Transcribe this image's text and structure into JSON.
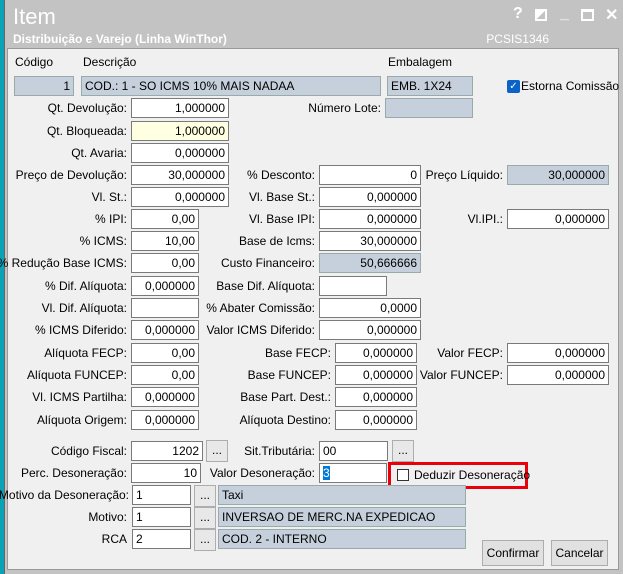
{
  "window": {
    "title": "Item",
    "subtitle": "Distribuição e Varejo (Linha WinThor)",
    "code": "PCSIS1346",
    "help": "?",
    "min": "_",
    "close": "✕"
  },
  "header": {
    "codigo_label": "Código",
    "codigo": "1",
    "descricao_label": "Descrição",
    "descricao": "COD.: 1 - SO ICMS 10% MAIS NADAA",
    "embalagem_label": "Embalagem",
    "embalagem": "EMB. 1X24",
    "estorna_label": "Estorna Comissão",
    "estorna_checked": true
  },
  "col1": [
    {
      "label": "Qt. Devolução:",
      "value": "1,000000"
    },
    {
      "label": "Qt. Bloqueada:",
      "value": "1,000000"
    },
    {
      "label": "Qt. Avaria:",
      "value": "0,000000"
    },
    {
      "label": "Preço de Devolução:",
      "value": "30,000000"
    },
    {
      "label": "Vl. St.:",
      "value": "0,000000"
    },
    {
      "label": "% IPI:",
      "value": "0,00"
    },
    {
      "label": "% ICMS:",
      "value": "10,00"
    },
    {
      "label": "% Redução Base ICMS:",
      "value": "0,00"
    },
    {
      "label": "% Dif. Alíquota:",
      "value": "0,000000"
    },
    {
      "label": "Vl. Dif. Alíquota:",
      "value": ""
    },
    {
      "label": "% ICMS Diferido:",
      "value": "0,000000"
    },
    {
      "label": "Alíquota FECP:",
      "value": "0,00"
    },
    {
      "label": "Alíquota FUNCEP:",
      "value": "0,00"
    },
    {
      "label": "Vl. ICMS Partilha:",
      "value": "0,000000"
    },
    {
      "label": "Alíquota Origem:",
      "value": "0,000000"
    }
  ],
  "col2": [
    {
      "label": "Número Lote:",
      "value": ""
    },
    {
      "label": "% Desconto:",
      "value": "0"
    },
    {
      "label": "Vl. Base St.:",
      "value": "0,000000"
    },
    {
      "label": "Vl. Base IPI:",
      "value": "0,000000"
    },
    {
      "label": "Base de Icms:",
      "value": "30,000000"
    },
    {
      "label": "Custo Financeiro:",
      "value": "50,666666"
    },
    {
      "label": "Base Dif. Alíquota:",
      "value": ""
    },
    {
      "label": "% Abater Comissão:",
      "value": "0,0000"
    },
    {
      "label": "Valor ICMS Diferido:",
      "value": "0,000000"
    },
    {
      "label": "Base FECP:",
      "value": "0,000000"
    },
    {
      "label": "Base FUNCEP:",
      "value": "0,000000"
    },
    {
      "label": "Base Part. Dest.:",
      "value": "0,000000"
    },
    {
      "label": "Alíquota Destino:",
      "value": "0,000000"
    }
  ],
  "col3": [
    {
      "label": "Preço Líquido:",
      "value": "30,000000"
    },
    {
      "label": "Vl.IPI.:",
      "value": "0,000000"
    },
    {
      "label": "Valor FECP:",
      "value": "0,000000"
    },
    {
      "label": "Valor FUNCEP:",
      "value": "0,000000"
    }
  ],
  "bottom": {
    "codigo_fiscal_label": "Código Fiscal:",
    "codigo_fiscal": "1202",
    "sit_trib_label": "Sit.Tributária:",
    "sit_trib": "00",
    "perc_des_label": "Perc. Desoneração:",
    "perc_des": "10",
    "valor_des_label": "Valor Desoneração:",
    "valor_des": "3",
    "deduzir_label": "Deduzir Desoneração",
    "deduzir_checked": false,
    "motivo_des_label": "Motivo da Desoneração:",
    "motivo_des": "1",
    "motivo_des_desc": "Taxi",
    "motivo_label": "Motivo:",
    "motivo": "1",
    "motivo_desc": "INVERSAO DE MERC.NA EXPEDICAO",
    "rca_label": "RCA",
    "rca": "2",
    "rca_desc": "COD. 2 - INTERNO",
    "dots": "...",
    "highlight_color": "#e8000b"
  },
  "buttons": {
    "confirmar": "Confirmar",
    "cancelar": "Cancelar"
  }
}
